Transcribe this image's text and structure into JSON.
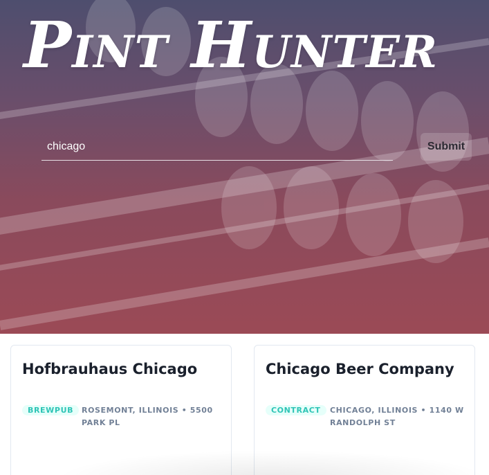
{
  "header": {
    "title": "Pint Hunter"
  },
  "search": {
    "value": "chicago",
    "submit_label": "Submit"
  },
  "results": [
    {
      "name": "Hofbrauhaus Chicago",
      "type": "BREWPUB",
      "address": "ROSEMONT, ILLINOIS • 5500 PARK PL"
    },
    {
      "name": "Chicago Beer Company",
      "type": "CONTRACT",
      "address": "CHICAGO, ILLINOIS • 1140 W RANDOLPH ST"
    }
  ],
  "colors": {
    "badge_text": "#2ec4b6",
    "badge_bg": "#e6fffa",
    "card_border": "#e2e8f0",
    "address_text": "#718096",
    "hero_top": "#4e4e6e",
    "hero_bottom": "#9b4a56"
  }
}
